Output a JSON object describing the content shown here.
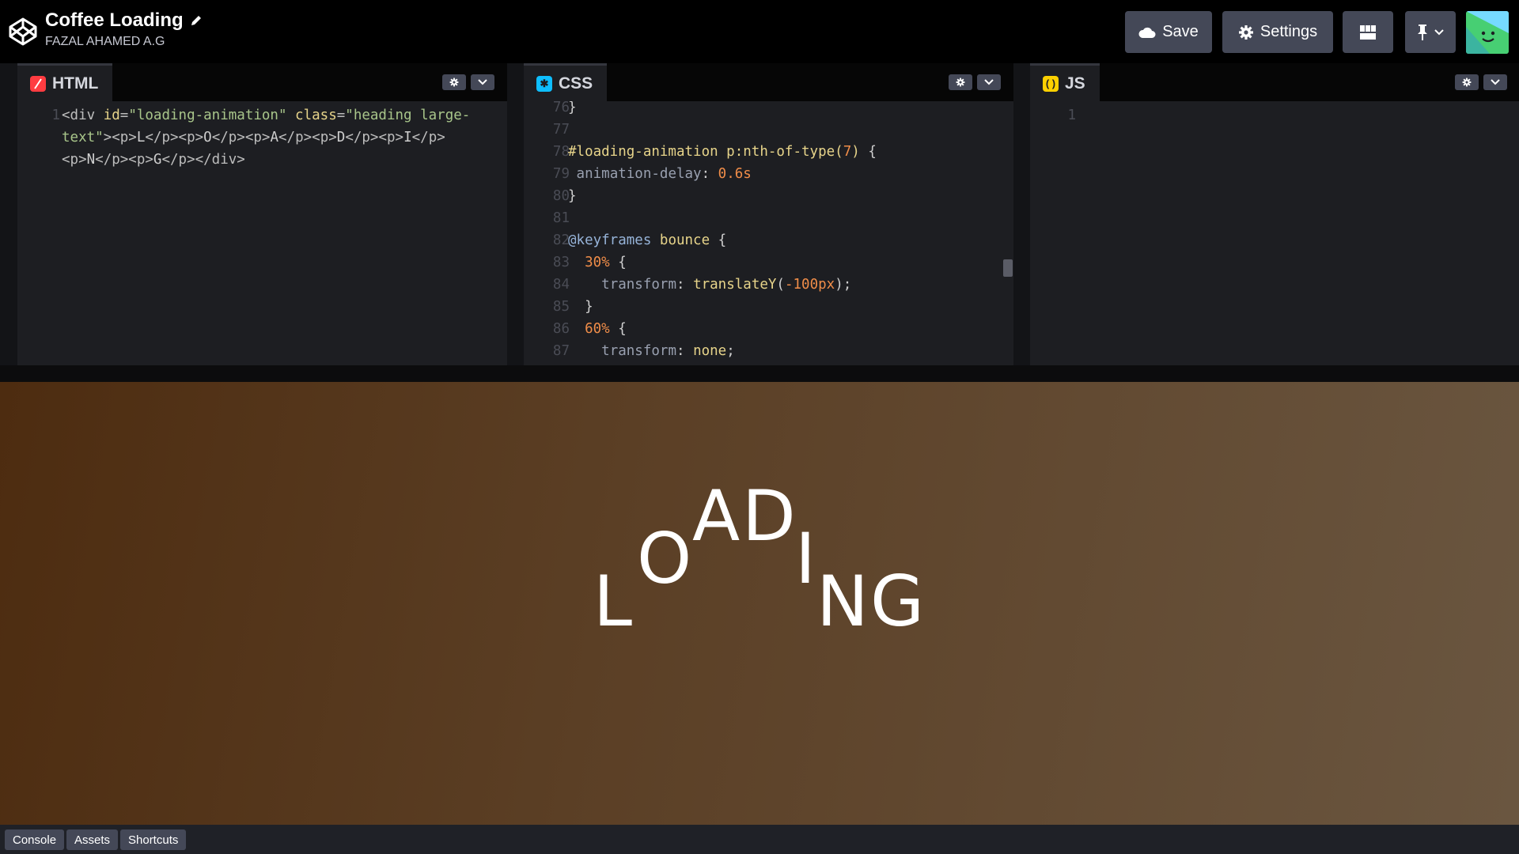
{
  "header": {
    "title": "Coffee Loading",
    "author": "FAZAL AHAMED A.G",
    "save_label": "Save",
    "settings_label": "Settings"
  },
  "html_editor": {
    "tab_label": "HTML",
    "icon_color": "#ff3c41",
    "lines": [
      {
        "num": "1",
        "parts": [
          [
            "k-tag",
            "<div "
          ],
          [
            "k-attr",
            "id"
          ],
          [
            "k-tag",
            "="
          ],
          [
            "k-str",
            "\"loading-animation\""
          ],
          [
            "k-tag",
            " "
          ],
          [
            "k-attr",
            "class"
          ],
          [
            "k-tag",
            "="
          ],
          [
            "k-str",
            "\"heading large-"
          ]
        ]
      },
      {
        "num": "",
        "parts": [
          [
            "k-str",
            "text\""
          ],
          [
            "k-tag",
            "><p>"
          ],
          [
            "",
            "L"
          ],
          [
            "k-tag",
            "</p><p>"
          ],
          [
            "",
            "O"
          ],
          [
            "k-tag",
            "</p><p>"
          ],
          [
            "",
            "A"
          ],
          [
            "k-tag",
            "</p><p>"
          ],
          [
            "",
            "D"
          ],
          [
            "k-tag",
            "</p><p>"
          ],
          [
            "",
            "I"
          ],
          [
            "k-tag",
            "</p>"
          ]
        ]
      },
      {
        "num": "",
        "parts": [
          [
            "k-tag",
            "<p>"
          ],
          [
            "",
            "N"
          ],
          [
            "k-tag",
            "</p><p>"
          ],
          [
            "",
            "G"
          ],
          [
            "k-tag",
            "</p></div>"
          ]
        ]
      }
    ]
  },
  "css_editor": {
    "tab_label": "CSS",
    "icon_color": "#0ebeff",
    "lines": [
      {
        "num": "76",
        "parts": [
          [
            "",
            "}"
          ]
        ]
      },
      {
        "num": "77",
        "parts": []
      },
      {
        "num": "78",
        "parts": [
          [
            "k-sel",
            "#loading-animation p:nth-of-type("
          ],
          [
            "k-num",
            "7"
          ],
          [
            "k-sel",
            ")"
          ],
          [
            "",
            " {"
          ]
        ]
      },
      {
        "num": "79",
        "parts": [
          [
            "",
            " "
          ],
          [
            "k-prop",
            "animation-delay"
          ],
          [
            "",
            ": "
          ],
          [
            "k-num",
            "0.6s"
          ]
        ]
      },
      {
        "num": "80",
        "parts": [
          [
            "",
            "}"
          ]
        ]
      },
      {
        "num": "81",
        "parts": []
      },
      {
        "num": "82",
        "parts": [
          [
            "k-at",
            "@keyframes"
          ],
          [
            "",
            " "
          ],
          [
            "k-fn",
            "bounce"
          ],
          [
            "",
            " {"
          ]
        ]
      },
      {
        "num": "83",
        "parts": [
          [
            "",
            "  "
          ],
          [
            "k-num",
            "30%"
          ],
          [
            "",
            " {"
          ]
        ]
      },
      {
        "num": "84",
        "parts": [
          [
            "",
            "    "
          ],
          [
            "k-prop",
            "transform"
          ],
          [
            "",
            ": "
          ],
          [
            "k-fn",
            "translateY"
          ],
          [
            "",
            "("
          ],
          [
            "k-num",
            "-100px"
          ],
          [
            "",
            ");"
          ]
        ]
      },
      {
        "num": "85",
        "parts": [
          [
            "",
            "  }"
          ]
        ]
      },
      {
        "num": "86",
        "parts": [
          [
            "",
            "  "
          ],
          [
            "k-num",
            "60%"
          ],
          [
            "",
            " {"
          ]
        ]
      },
      {
        "num": "87",
        "parts": [
          [
            "",
            "    "
          ],
          [
            "k-prop",
            "transform"
          ],
          [
            "",
            ": "
          ],
          [
            "k-fn",
            "none"
          ],
          [
            "",
            ";"
          ]
        ]
      }
    ]
  },
  "js_editor": {
    "tab_label": "JS",
    "icon_color": "#fcd000",
    "lines": [
      {
        "num": "1",
        "parts": []
      }
    ]
  },
  "preview": {
    "letters": [
      "L",
      "O",
      "A",
      "D",
      "I",
      "N",
      "G"
    ]
  },
  "footer": {
    "console_label": "Console",
    "assets_label": "Assets",
    "shortcuts_label": "Shortcuts"
  }
}
